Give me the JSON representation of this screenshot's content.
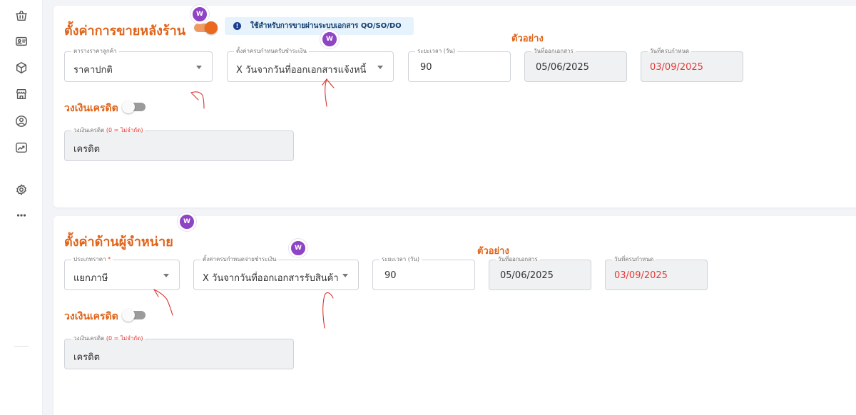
{
  "sidebar": {
    "icons": [
      "basket-icon",
      "id-card-icon",
      "box-icon",
      "store-icon",
      "user-circle-icon",
      "trend-chart-icon",
      "settings-icon",
      "more-icon"
    ]
  },
  "sales": {
    "title": "ตั้งค่าการขายหลังร้าน",
    "toggle_on": true,
    "info": "ใช้สำหรับการขายผ่านระบบเอกสาร QO/SO/DO",
    "example": "ตัวอย่าง",
    "price_table": {
      "label": "ตารางราคาลูกค้า",
      "value": "ราคาปกติ"
    },
    "payment_due": {
      "label": "ตั้งค่าครบกำหนดรับชำระเงิน",
      "value": "X วันจากวันที่ออกเอกสารแจ้งหนี้"
    },
    "duration": {
      "label": "ระยะเวลา (วัน)",
      "value": "90"
    },
    "issue_date": {
      "label": "วันที่ออกเอกสาร",
      "value": "05/06/2025"
    },
    "due_date": {
      "label": "วันที่ครบกำหนด",
      "value": "03/09/2025"
    },
    "credit_title": "วงเงินเครดิต",
    "credit_toggle_on": false,
    "credit": {
      "label": "วงเงินเครดิต",
      "hint": "(0 = ไม่จำกัด)",
      "value": "เครดิต"
    }
  },
  "supplier": {
    "title": "ตั้งค่าด้านผู้จำหน่าย",
    "example": "ตัวอย่าง",
    "price_type": {
      "label": "ประเภทราคา",
      "required": "*",
      "value": "แยกภาษี"
    },
    "payment_due": {
      "label": "ตั้งค่าครบกำหนดจ่ายชำระเงิน",
      "value": "X วันจากวันที่ออกเอกสารรับสินค้า"
    },
    "duration": {
      "label": "ระยะเวลา (วัน)",
      "value": "90"
    },
    "issue_date": {
      "label": "วันที่ออกเอกสาร",
      "value": "05/06/2025"
    },
    "due_date": {
      "label": "วันที่ครบกำหนด",
      "value": "03/09/2025"
    },
    "credit_title": "วงเงินเครดิต",
    "credit_toggle_on": false,
    "credit": {
      "label": "วงเงินเครดิต",
      "hint": "(0 = ไม่จำกัด)",
      "value": "เครดิต"
    }
  },
  "avatar_initial": "W",
  "colors": {
    "accent": "#e0641a",
    "due_red": "#e53935",
    "avatar": "#8e44c4",
    "info_bg": "#e6f3fc"
  }
}
